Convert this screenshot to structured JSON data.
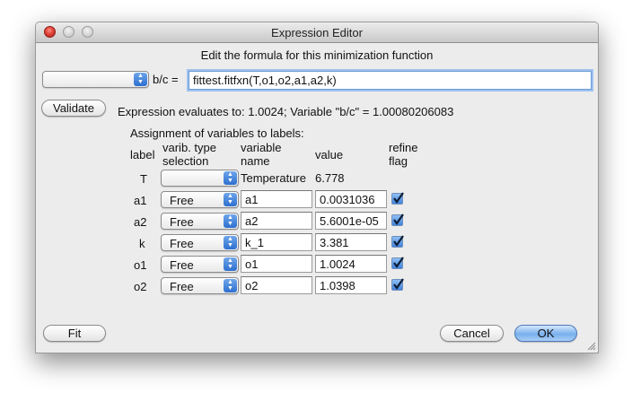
{
  "window": {
    "title": "Expression Editor"
  },
  "header": {
    "instruction": "Edit the formula for this minimization function"
  },
  "formula": {
    "target_select_value": "",
    "target_label": "b/c =",
    "expression": "fittest.fitfxn(T,o1,o2,a1,a2,k)"
  },
  "validate": {
    "button_label": "Validate",
    "status": "Expression evaluates to: 1.0024; Variable \"b/c\" = 1.00080206083"
  },
  "assignment": {
    "heading": "Assignment of variables to labels:",
    "columns": {
      "label": "label",
      "type_line1": "varib. type",
      "type_line2": "selection",
      "name_line1": "variable",
      "name_line2": "name",
      "value": "value",
      "refine_line1": "refine",
      "refine_line2": "flag"
    },
    "rows": [
      {
        "label": "T",
        "type": "",
        "name": "Temperature",
        "value": "6.778",
        "refine": null,
        "editable": false
      },
      {
        "label": "a1",
        "type": "Free",
        "name": "a1",
        "value": "0.0031036",
        "refine": true,
        "editable": true
      },
      {
        "label": "a2",
        "type": "Free",
        "name": "a2",
        "value": "5.6001e-05",
        "refine": true,
        "editable": true
      },
      {
        "label": "k",
        "type": "Free",
        "name": "k_1",
        "value": "3.381",
        "refine": true,
        "editable": true
      },
      {
        "label": "o1",
        "type": "Free",
        "name": "o1",
        "value": "1.0024",
        "refine": true,
        "editable": true
      },
      {
        "label": "o2",
        "type": "Free",
        "name": "o2",
        "value": "1.0398",
        "refine": true,
        "editable": true
      }
    ]
  },
  "footer": {
    "fit_label": "Fit",
    "cancel_label": "Cancel",
    "ok_label": "OK"
  },
  "colors": {
    "window_bg": "#ececec",
    "accent": "#3f82dc",
    "focus_ring": "#9ec2f0"
  }
}
